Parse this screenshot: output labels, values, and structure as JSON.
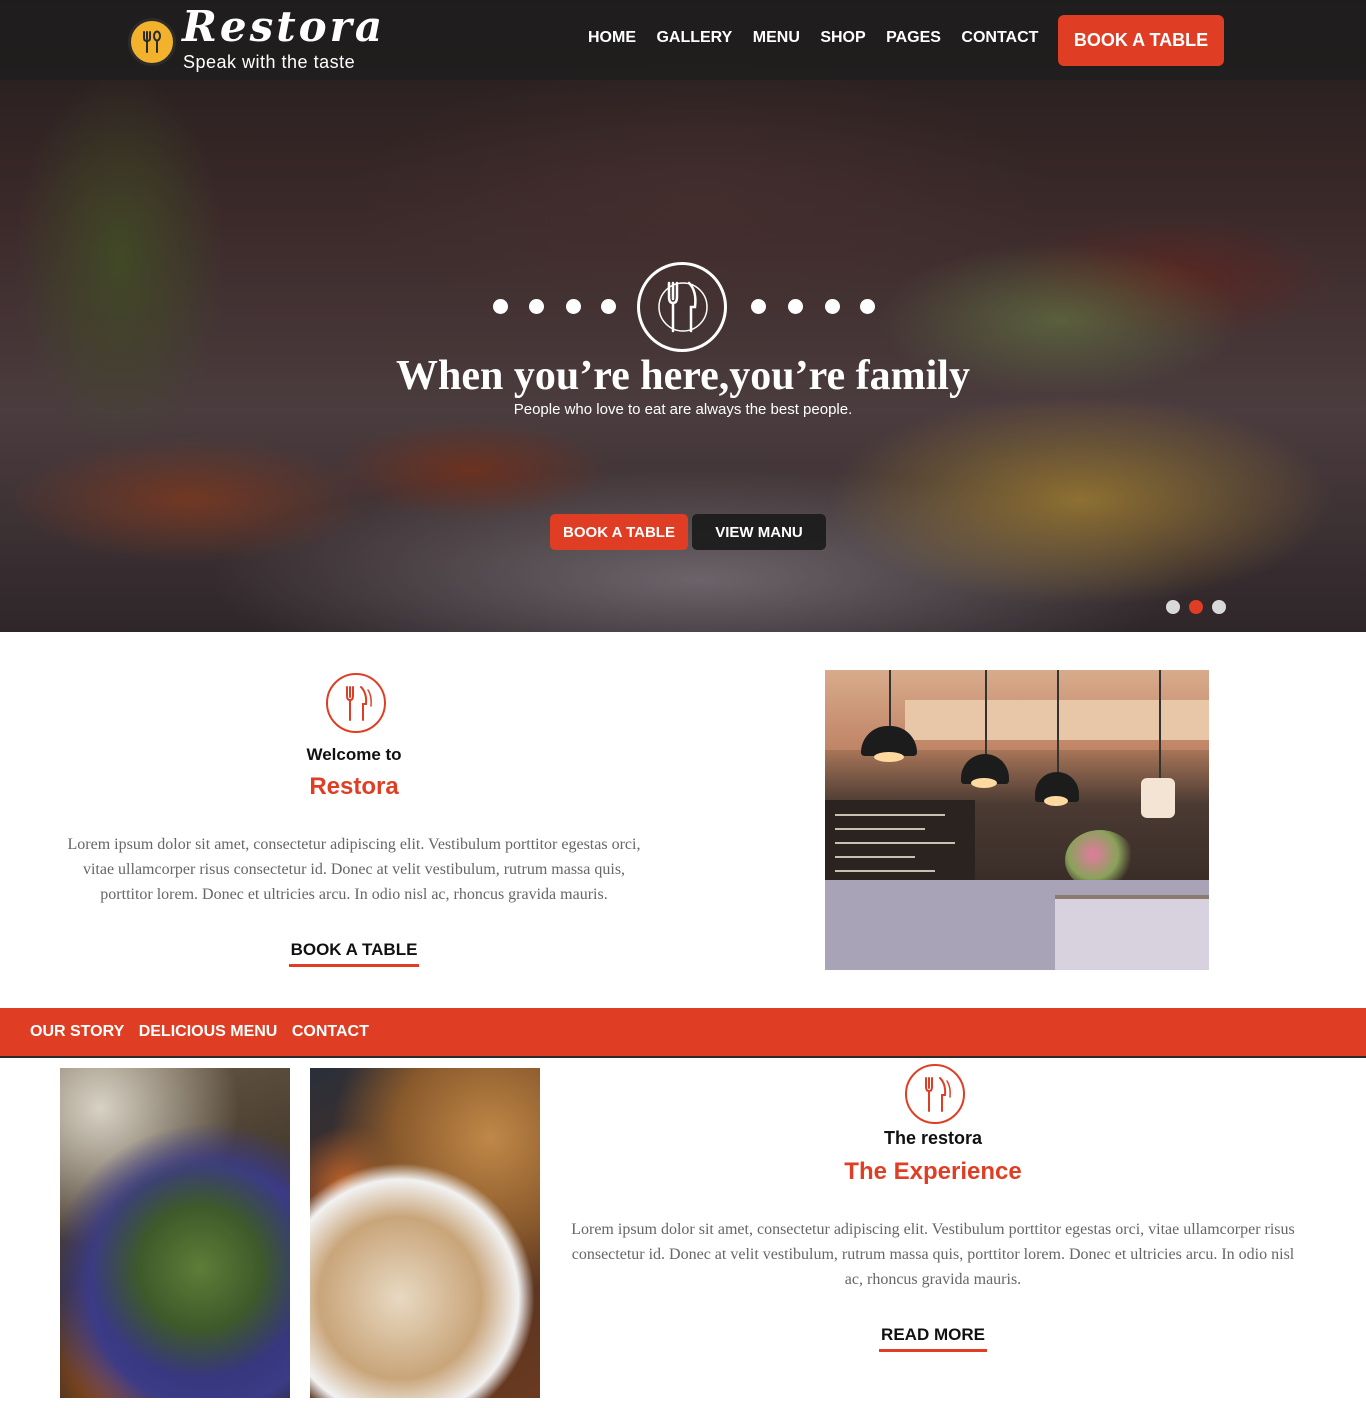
{
  "brand": {
    "name": "Restora",
    "tagline": "Speak with the taste",
    "accent_color": "#e03e24",
    "logo_icon": "fork-spoon-icon"
  },
  "nav": {
    "items": [
      {
        "label": "HOME"
      },
      {
        "label": "GALLERY"
      },
      {
        "label": "MENU"
      },
      {
        "label": "SHOP"
      },
      {
        "label": "PAGES"
      },
      {
        "label": "CONTACT"
      }
    ],
    "cta_label": "BOOK A TABLE"
  },
  "hero": {
    "title": "When you’re here,you’re family",
    "subtitle": "People who love to eat are always the best people.",
    "primary_button": "BOOK A TABLE",
    "secondary_button": "VIEW MANU",
    "emblem_icon": "fork-knife-plate-icon",
    "slider": {
      "count": 3,
      "active_index": 1
    }
  },
  "welcome": {
    "pretitle": "Welcome to",
    "title": "Restora",
    "body": "Lorem ipsum dolor sit amet, consectetur adipiscing elit. Vestibulum porttitor egestas orci, vitae ullamcorper risus consectetur id. Donec at velit vestibulum, rutrum massa quis, porttitor lorem. Donec et ultricies arcu. In odio nisl ac, rhoncus gravida mauris.",
    "link_label": "BOOK A TABLE",
    "photo": "restaurant-interior-photo"
  },
  "section_nav": {
    "items": [
      {
        "label": "OUR STORY"
      },
      {
        "label": "DELICIOUS MENU"
      },
      {
        "label": "CONTACT"
      }
    ]
  },
  "experience": {
    "pretitle": "The restora",
    "title": "The Experience",
    "body": "Lorem ipsum dolor sit amet, consectetur adipiscing elit. Vestibulum porttitor egestas orci, vitae ullamcorper risus consectetur id. Donec at velit vestibulum, rutrum massa quis, porttitor lorem. Donec et ultricies arcu. In odio nisl ac, rhoncus gravida mauris.",
    "link_label": "READ MORE",
    "photos": [
      "salad-plate-photo",
      "bean-salad-photo"
    ]
  }
}
